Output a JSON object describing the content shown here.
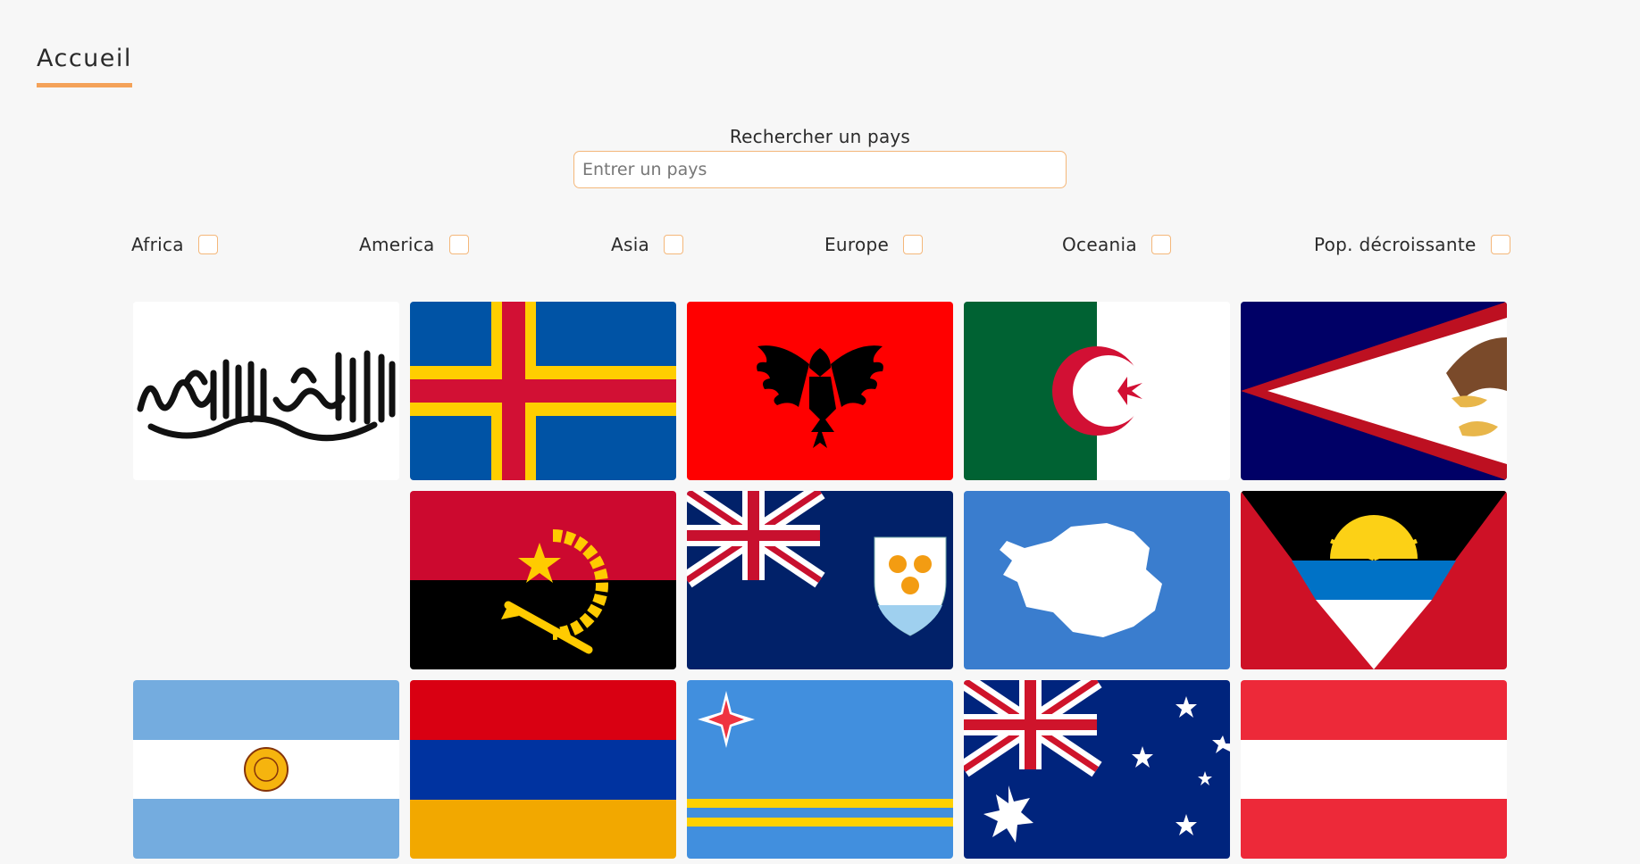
{
  "nav": {
    "home_label": "Accueil"
  },
  "search": {
    "label": "Rechercher un pays",
    "placeholder": "Entrer un pays",
    "value": ""
  },
  "filters": [
    {
      "label": "Africa",
      "checked": false
    },
    {
      "label": "America",
      "checked": false
    },
    {
      "label": "Asia",
      "checked": false
    },
    {
      "label": "Europe",
      "checked": false
    },
    {
      "label": "Oceania",
      "checked": false
    },
    {
      "label": "Pop. décroissante",
      "checked": false
    }
  ],
  "accent_color": "#f4a259",
  "flags": [
    {
      "icon": "afghanistan-flag-icon"
    },
    {
      "icon": "aland-islands-flag-icon"
    },
    {
      "icon": "albania-flag-icon"
    },
    {
      "icon": "algeria-flag-icon"
    },
    {
      "icon": "american-samoa-flag-icon"
    },
    {
      "icon": "andorra-flag-icon-blank"
    },
    {
      "icon": "angola-flag-icon"
    },
    {
      "icon": "anguilla-flag-icon"
    },
    {
      "icon": "antarctica-flag-icon"
    },
    {
      "icon": "antigua-and-barbuda-flag-icon"
    },
    {
      "icon": "argentina-flag-icon"
    },
    {
      "icon": "armenia-flag-icon"
    },
    {
      "icon": "aruba-flag-icon"
    },
    {
      "icon": "australia-flag-icon"
    },
    {
      "icon": "austria-flag-icon"
    }
  ]
}
